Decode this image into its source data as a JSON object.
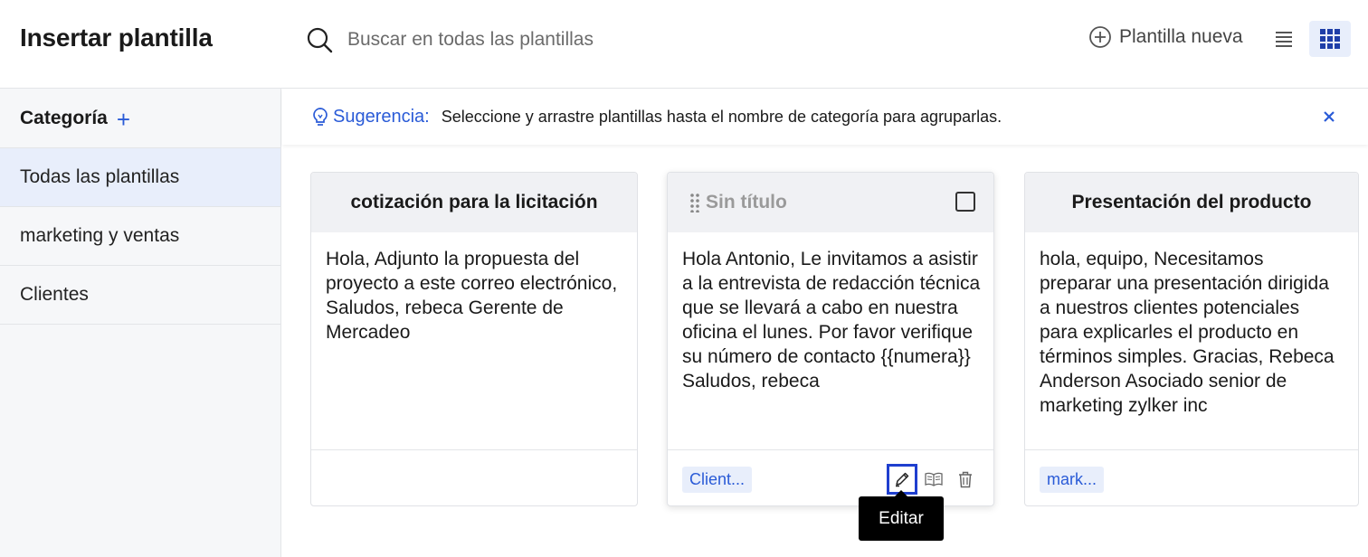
{
  "header": {
    "title": "Insertar plantilla",
    "search_placeholder": "Buscar en todas las plantillas",
    "new_template_label": "Plantilla nueva"
  },
  "sidebar": {
    "heading": "Categoría",
    "add_symbol": "+",
    "items": [
      {
        "label": "Todas las plantillas",
        "active": true
      },
      {
        "label": "marketing y ventas",
        "active": false
      },
      {
        "label": "Clientes",
        "active": false
      }
    ]
  },
  "tip": {
    "label": "Sugerencia:",
    "text": "Seleccione y arrastre plantillas hasta el nombre de categoría para agruparlas."
  },
  "cards": [
    {
      "title": "cotización para la licitación",
      "body": "Hola, Adjunto la propuesta del proyecto a este correo electrónico, Saludos, rebeca Gerente de Mercadeo",
      "tag": ""
    },
    {
      "title": "Sin título",
      "body": "Hola Antonio, Le invitamos a asistir a la entrevista de redacción técnica que se llevará a cabo en nuestra oficina el lunes. Por favor verifique su número de contacto {{numera}} Saludos, rebeca",
      "tag": "Client..."
    },
    {
      "title": "Presentación del producto",
      "body": "hola, equipo, Necesitamos preparar una presentación dirigida a nuestros clientes potenciales para explicarles el producto en términos simples. Gracias, Rebeca Anderson Asociado senior de marketing zylker inc",
      "tag": "mark..."
    }
  ],
  "tooltip": {
    "label": "Editar"
  },
  "colors": {
    "accent": "#2a5bd7",
    "active_bg": "#e8eefb",
    "focus_border": "#1f3fcf"
  },
  "icons": {
    "search": "search-icon",
    "new_template": "plus-circle-icon",
    "list_view": "list-view-icon",
    "grid_view": "grid-view-icon",
    "tip": "lightbulb-icon",
    "close": "close-icon",
    "drag": "drag-handle-icon",
    "edit": "pencil-icon",
    "preview": "book-open-icon",
    "delete": "trash-icon"
  }
}
